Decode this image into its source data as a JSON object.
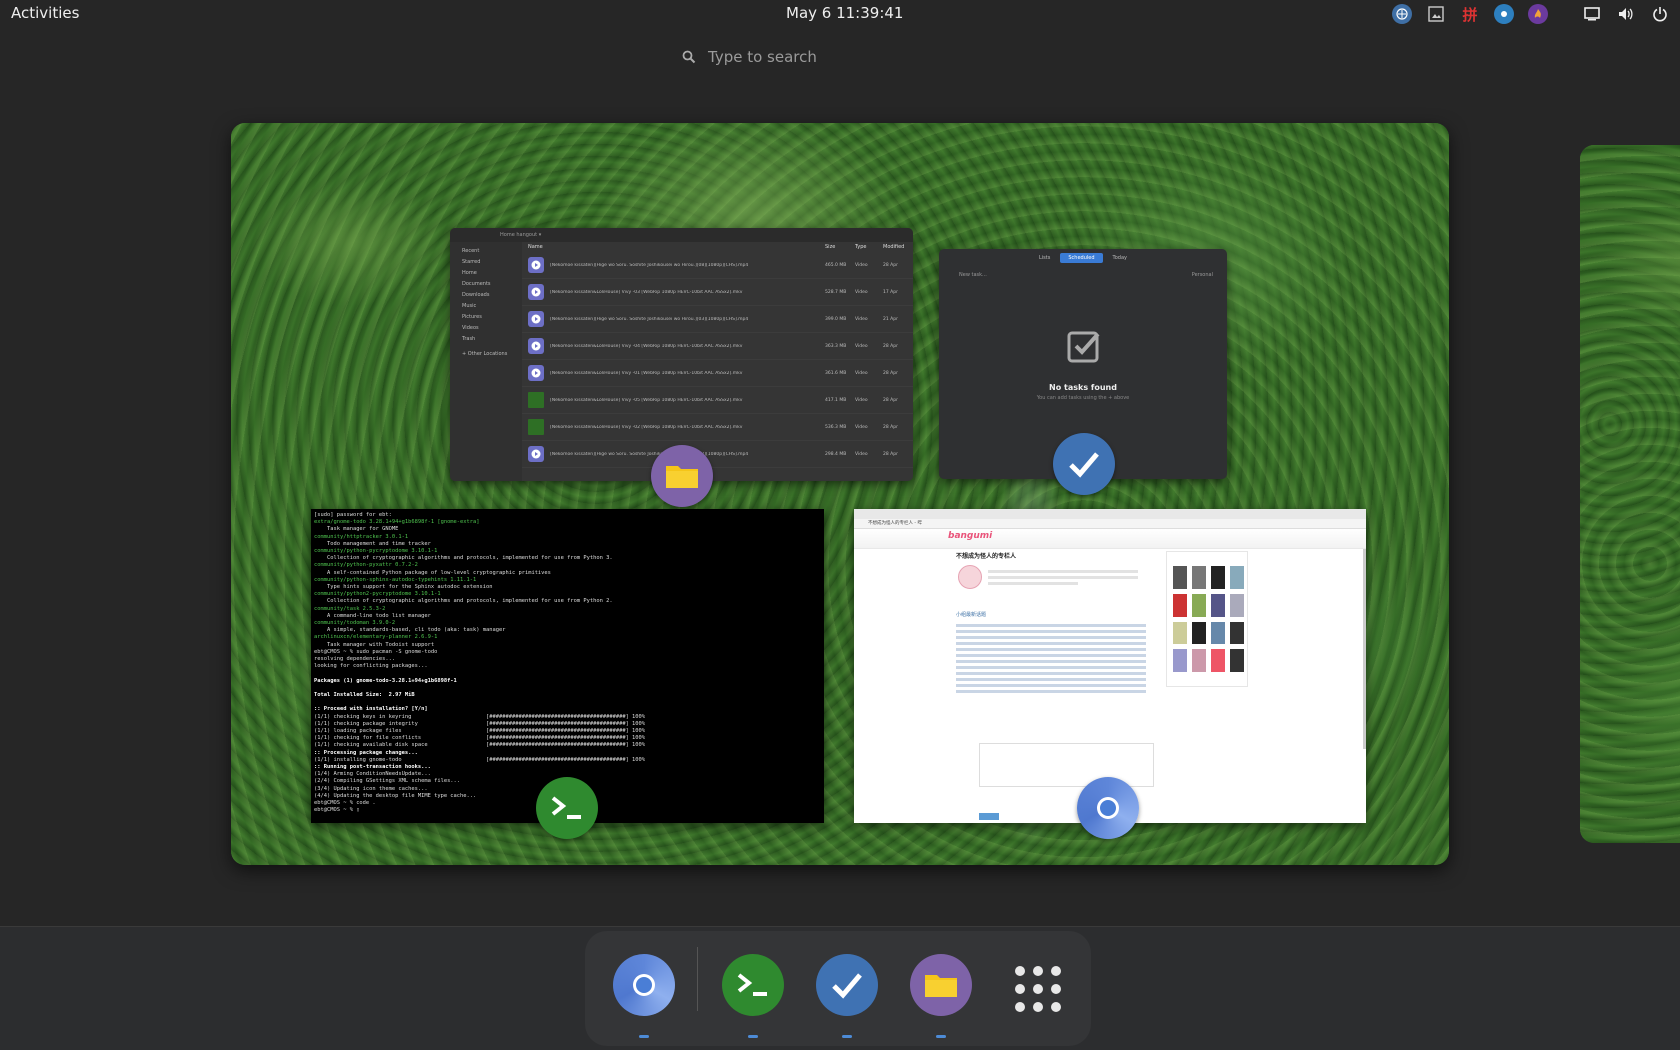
{
  "topbar": {
    "activities": "Activities",
    "clock": "May 6  11:39:41",
    "tray": [
      "input-method-icon",
      "screenshot-icon",
      "pinyin-icon",
      "indicator-app-icon",
      "flame-app-icon",
      "display-icon",
      "volume-icon",
      "power-icon"
    ],
    "pinyin_label": "拼"
  },
  "search": {
    "placeholder": "Type to search"
  },
  "files_window": {
    "path": "Home   hangout ▾",
    "sidebar": [
      "Recent",
      "Starred",
      "Home",
      "Documents",
      "Downloads",
      "Music",
      "Pictures",
      "Videos",
      "Trash",
      "+ Other Locations"
    ],
    "columns": [
      "Name",
      "Size",
      "Type",
      "Modified"
    ],
    "rows": [
      {
        "name": "[Nekomoe kissaten][Hige wo Soru. Soshite Joshikousei wo Hirou.][08][1080p][CHS].mp4",
        "size": "465.0 MB",
        "type": "Video",
        "modified": "28 Apr",
        "icon": "video"
      },
      {
        "name": "[Nekomoe kissaten&LoliHouse] Vivy -03 [WebRip 1080p HEVC-10bit AAC ASSx2].mkv",
        "size": "528.7 MB",
        "type": "Video",
        "modified": "17 Apr",
        "icon": "video"
      },
      {
        "name": "[Nekomoe kissaten][Hige wo Soru. Soshite Joshikousei wo Hirou.][03][1080p][CHS].mp4",
        "size": "399.0 MB",
        "type": "Video",
        "modified": "21 Apr",
        "icon": "video"
      },
      {
        "name": "[Nekomoe kissaten&LoliHouse] Vivy -04 [WebRip 1080p HEVC-10bit AAC ASSx2].mkv",
        "size": "363.3 MB",
        "type": "Video",
        "modified": "28 Apr",
        "icon": "video"
      },
      {
        "name": "[Nekomoe kissaten&LoliHouse] Vivy -01 [WebRip 1080p HEVC-10bit AAC ASSx2].mkv",
        "size": "361.6 MB",
        "type": "Video",
        "modified": "28 Apr",
        "icon": "video"
      },
      {
        "name": "[Nekomoe kissaten&LoliHouse] Vivy -05 [WebRip 1080p HEVC-10bit AAC ASSx2].mkv",
        "size": "417.1 MB",
        "type": "Video",
        "modified": "28 Apr",
        "icon": "image"
      },
      {
        "name": "[Nekomoe kissaten&LoliHouse] Vivy -02 [WebRip 1080p HEVC-10bit AAC ASSx2].mkv",
        "size": "536.3 MB",
        "type": "Video",
        "modified": "28 Apr",
        "icon": "image"
      },
      {
        "name": "[Nekomoe kissaten][Hige wo Soru. Soshite Joshikousei wo Hirou.][02][1080p][CHS].mp4",
        "size": "298.4 MB",
        "type": "Video",
        "modified": "28 Apr",
        "icon": "video"
      }
    ]
  },
  "todo_window": {
    "tabs": [
      "Lists",
      "Scheduled",
      "Today"
    ],
    "active_tab": "Scheduled",
    "new_task": "New task...",
    "list_name": "Personal",
    "empty_title": "No tasks found",
    "empty_subtitle": "You can add tasks using the + above"
  },
  "terminal_window": {
    "lines": [
      {
        "t": "[sudo] password for ebt:",
        "c": ""
      },
      {
        "t": "extra/gnome-todo 3.28.1+94+g1b6898f-1 [gnome-extra]",
        "c": "g"
      },
      {
        "t": "    Task manager for GNOME",
        "c": ""
      },
      {
        "t": "community/httptracker 3.0.1-1",
        "c": "g"
      },
      {
        "t": "    Todo management and time tracker",
        "c": ""
      },
      {
        "t": "community/python-pycryptodome 3.10.1-1",
        "c": "g"
      },
      {
        "t": "    Collection of cryptographic algorithms and protocols, implemented for use from Python 3.",
        "c": ""
      },
      {
        "t": "community/python-pyxattr 0.7.2-2",
        "c": "g"
      },
      {
        "t": "    A self-contained Python package of low-level cryptographic primitives",
        "c": ""
      },
      {
        "t": "community/python-sphinx-autodoc-typehints 1.11.1-1",
        "c": "g"
      },
      {
        "t": "    Type hints support for the Sphinx autodoc extension",
        "c": ""
      },
      {
        "t": "community/python2-pycryptodome 3.10.1-1",
        "c": "g"
      },
      {
        "t": "    Collection of cryptographic algorithms and protocols, implemented for use from Python 2.",
        "c": ""
      },
      {
        "t": "community/task 2.5.3-2",
        "c": "g"
      },
      {
        "t": "    A command-line todo list manager",
        "c": ""
      },
      {
        "t": "community/todoman 3.9.0-2",
        "c": "g"
      },
      {
        "t": "    A simple, standards-based, cli todo (aka: task) manager",
        "c": ""
      },
      {
        "t": "archlinuxcn/elementary-planner 2.6.9-1",
        "c": "g"
      },
      {
        "t": "    Task manager with Todoist support",
        "c": ""
      },
      {
        "t": "ebt@CMOS ~ % sudo pacman -S gnome-todo",
        "c": ""
      },
      {
        "t": "resolving dependencies...",
        "c": ""
      },
      {
        "t": "looking for conflicting packages...",
        "c": ""
      },
      {
        "t": "",
        "c": ""
      },
      {
        "t": "Packages (1) gnome-todo-3.28.1+94+g1b6898f-1",
        "c": "b"
      },
      {
        "t": "",
        "c": ""
      },
      {
        "t": "Total Installed Size:  2.97 MiB",
        "c": "b"
      },
      {
        "t": "",
        "c": ""
      },
      {
        "t": ":: Proceed with installation? [Y/n]",
        "c": "b"
      },
      {
        "t": "(1/1) checking keys in keyring                       [##########################################] 100%",
        "c": ""
      },
      {
        "t": "(1/1) checking package integrity                     [##########################################] 100%",
        "c": ""
      },
      {
        "t": "(1/1) loading package files                          [##########################################] 100%",
        "c": ""
      },
      {
        "t": "(1/1) checking for file conflicts                    [##########################################] 100%",
        "c": ""
      },
      {
        "t": "(1/1) checking available disk space                  [##########################################] 100%",
        "c": ""
      },
      {
        "t": ":: Processing package changes...",
        "c": "b"
      },
      {
        "t": "(1/1) installing gnome-todo                          [##########################################] 100%",
        "c": ""
      },
      {
        "t": ":: Running post-transaction hooks...",
        "c": "b"
      },
      {
        "t": "(1/4) Arming ConditionNeedsUpdate...",
        "c": ""
      },
      {
        "t": "(2/4) Compiling GSettings XML schema files...",
        "c": ""
      },
      {
        "t": "(3/4) Updating icon theme caches...",
        "c": ""
      },
      {
        "t": "(4/4) Updating the desktop file MIME type cache...",
        "c": ""
      },
      {
        "t": "ebt@CMOS ~ % code .",
        "c": ""
      },
      {
        "t": "ebt@CMOS ~ % ▯",
        "c": ""
      }
    ]
  },
  "browser_window": {
    "tab_title": "不想成为怪人的专栏人 - 哔",
    "site_logo": "bangumi",
    "page_title": "不想成为怪人的专栏人",
    "section_header": "小组最新话题"
  },
  "dock": {
    "items": [
      "chromium",
      "terminal",
      "todo",
      "files"
    ],
    "show_apps": "show-apps"
  },
  "colors": {
    "panel": "#262626",
    "dock": "#343537",
    "accent": "#4d8bd6",
    "terminal_green": "#2f8a2f",
    "todo_blue": "#3f72b3",
    "files_purple": "#7e63a8"
  }
}
